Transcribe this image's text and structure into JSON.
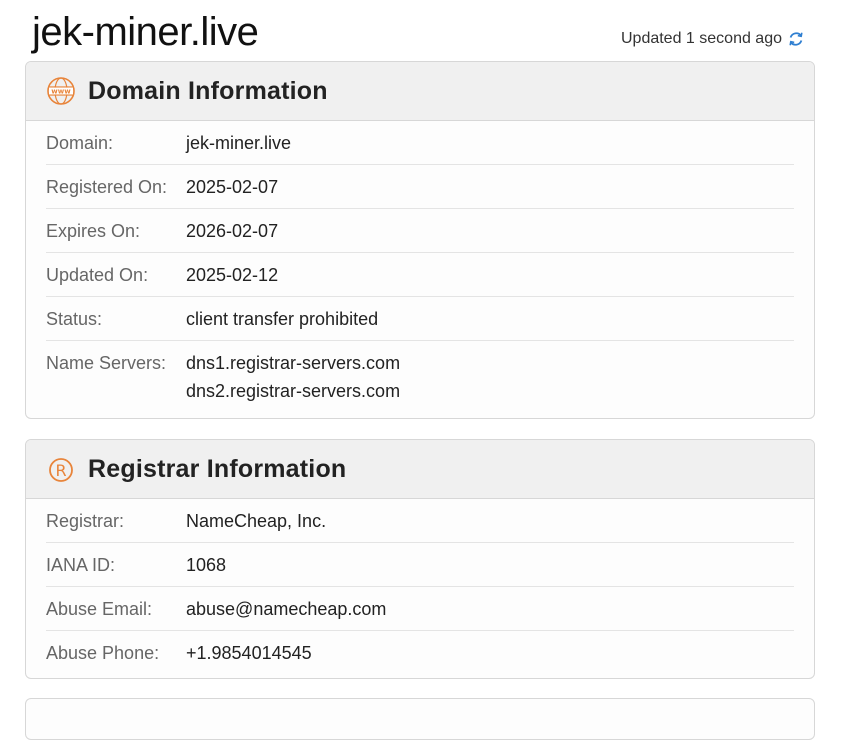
{
  "header": {
    "title": "jek-miner.live",
    "updated_text": "Updated 1 second ago"
  },
  "colors": {
    "accent": "#e8843a",
    "refresh": "#2f7fd1"
  },
  "domain_info": {
    "title": "Domain Information",
    "icon": "www-globe-icon",
    "rows": [
      {
        "label": "Domain:",
        "value": "jek-miner.live"
      },
      {
        "label": "Registered On:",
        "value": "2025-02-07"
      },
      {
        "label": "Expires On:",
        "value": "2026-02-07"
      },
      {
        "label": "Updated On:",
        "value": "2025-02-12"
      },
      {
        "label": "Status:",
        "value": "client transfer prohibited"
      }
    ],
    "name_servers": {
      "label": "Name Servers:",
      "values": [
        "dns1.registrar-servers.com",
        "dns2.registrar-servers.com"
      ]
    }
  },
  "registrar_info": {
    "title": "Registrar Information",
    "icon": "registered-icon",
    "rows": [
      {
        "label": "Registrar:",
        "value": "NameCheap, Inc."
      },
      {
        "label": "IANA ID:",
        "value": "1068"
      },
      {
        "label": "Abuse Email:",
        "value": "abuse@namecheap.com"
      },
      {
        "label": "Abuse Phone:",
        "value": "+1.9854014545"
      }
    ]
  }
}
